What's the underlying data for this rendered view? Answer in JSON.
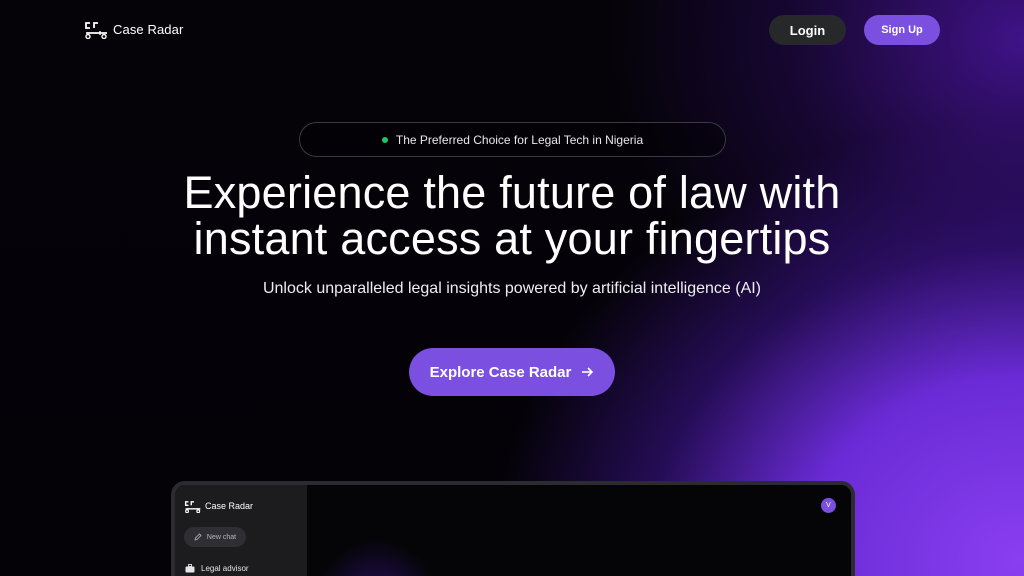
{
  "header": {
    "brand": "Case Radar",
    "login_label": "Login",
    "signup_label": "Sign Up"
  },
  "badge": {
    "text": "The Preferred Choice for Legal Tech in Nigeria",
    "dot_color": "#22c55e"
  },
  "hero": {
    "title_line1": "Experience the future of law with",
    "title_line2": "instant access at your fingertips",
    "subtitle": "Unlock unparalleled legal insights powered by artificial intelligence (AI)",
    "cta_label": "Explore Case Radar",
    "cta_icon": "arrow-right-icon"
  },
  "preview": {
    "brand": "Case Radar",
    "new_chat_label": "New chat",
    "sidebar_item": "Legal advisor",
    "avatar_initial": "V"
  },
  "colors": {
    "accent": "#7b4fe0",
    "login_bg": "#27282a",
    "background": "#000000"
  }
}
